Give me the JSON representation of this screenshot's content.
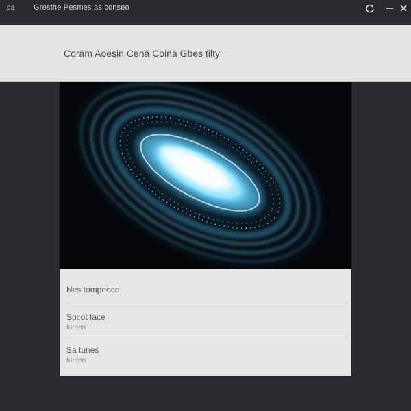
{
  "titlebar": {
    "app_icon_text": "pa",
    "title": "Gresthe Pesmes as conseo",
    "icons": [
      "refresh-icon",
      "minimize-icon",
      "close-icon"
    ]
  },
  "header": {
    "title": "Coram Aoesin Cena Coina Gbes tilty"
  },
  "hero": {
    "image": "glowing-blue-vortex-ellipse"
  },
  "list": {
    "items": [
      {
        "label": "Nes tompeoce",
        "sub": ""
      },
      {
        "label": "Socot tace",
        "sub": "tureen"
      },
      {
        "label": "Sa tunes",
        "sub": "tureen"
      }
    ]
  },
  "colors": {
    "titlebar": "#2a2b2e",
    "background": "#2b2c2f",
    "header": "#e3e3e3",
    "card": "#e6e6e6",
    "accent": "#6fd3ff"
  }
}
